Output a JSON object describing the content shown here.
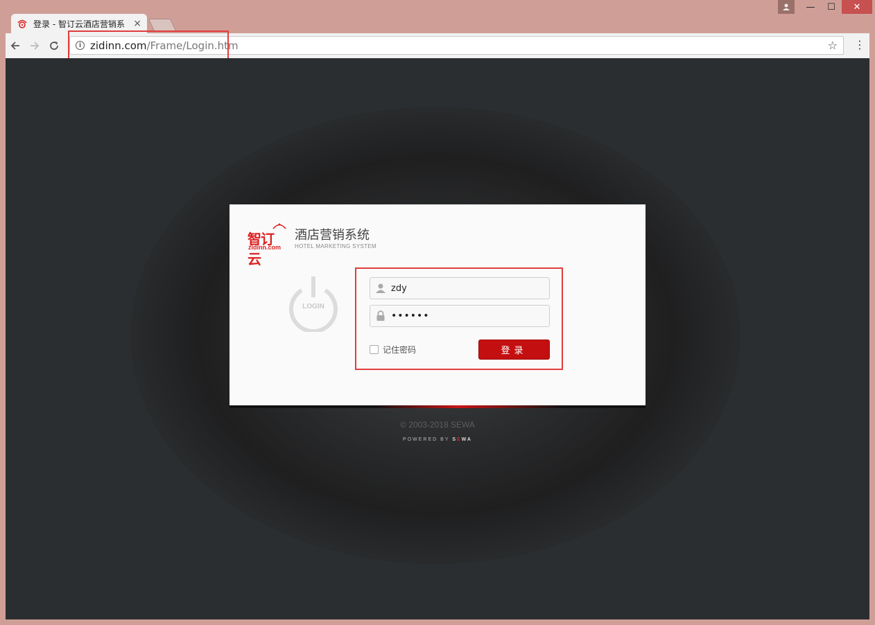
{
  "browser": {
    "tab_title": "登录 - 智订云酒店营销系",
    "tab_close": "×",
    "url_host": "zidinn.com",
    "url_path": "/Frame/Login.htm",
    "controls": {
      "minimize": "—",
      "maximize": "☐",
      "close": "✕"
    }
  },
  "logo": {
    "cn": "智订云",
    "en": "zidinn.com",
    "system_cn": "酒店营销系统",
    "system_en": "HOTEL MARKETING SYSTEM"
  },
  "login": {
    "power_label": "LOGIN",
    "username_value": "zdy",
    "password_value": "••••••",
    "remember_label": "记住密码",
    "remember_checked": false,
    "submit_label": "登录"
  },
  "footer": {
    "copyright": "© 2003-2018 SEWA",
    "powered_prefix": "POWERED BY",
    "powered_brand_s": "S",
    "powered_brand_o": "E",
    "powered_brand_rest": "WA"
  },
  "colors": {
    "accent": "#c40f10",
    "page_bg": "#2b2e30",
    "frame": "#cf9f97",
    "highlight": "#e03c3c"
  }
}
